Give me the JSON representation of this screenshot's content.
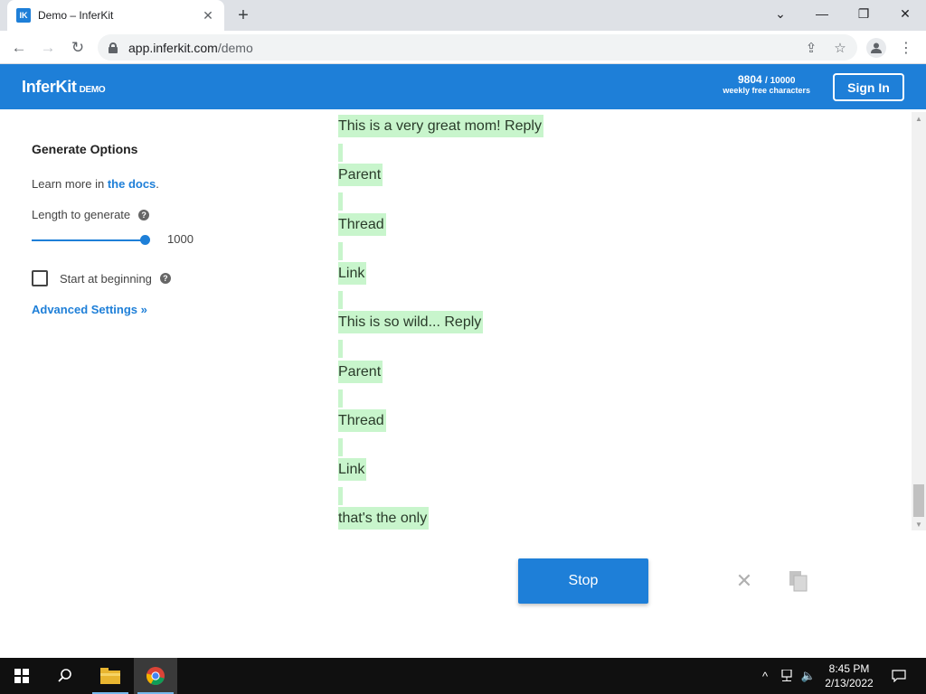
{
  "browser": {
    "tab_title": "Demo – InferKit",
    "favicon_text": "IK",
    "url_host": "app.inferkit.com",
    "url_path": "/demo"
  },
  "header": {
    "brand": "InferKit",
    "brand_tag": "DEMO",
    "quota_used": "9804",
    "quota_total": "/ 10000",
    "quota_desc": "weekly free characters",
    "signin_label": "Sign In"
  },
  "sidebar": {
    "title": "Generate Options",
    "learn_prefix": "Learn more in ",
    "learn_link": "the docs",
    "learn_suffix": ".",
    "length_label": "Length to generate",
    "length_value": "1000",
    "length_fraction": 1.0,
    "start_label": "Start at beginning",
    "start_checked": false,
    "advanced_label": "Advanced Settings »"
  },
  "output": {
    "lines": [
      "This is a very great mom! Reply",
      "Parent",
      "Thread",
      "Link",
      "This is so wild... Reply",
      "Parent",
      "Thread",
      "Link",
      "that's the only"
    ]
  },
  "actions": {
    "stop_label": "Stop"
  },
  "taskbar": {
    "time": "8:45 PM",
    "date": "2/13/2022"
  },
  "colors": {
    "brand_blue": "#1e7fd8",
    "highlight_green": "#c8f5cc"
  }
}
